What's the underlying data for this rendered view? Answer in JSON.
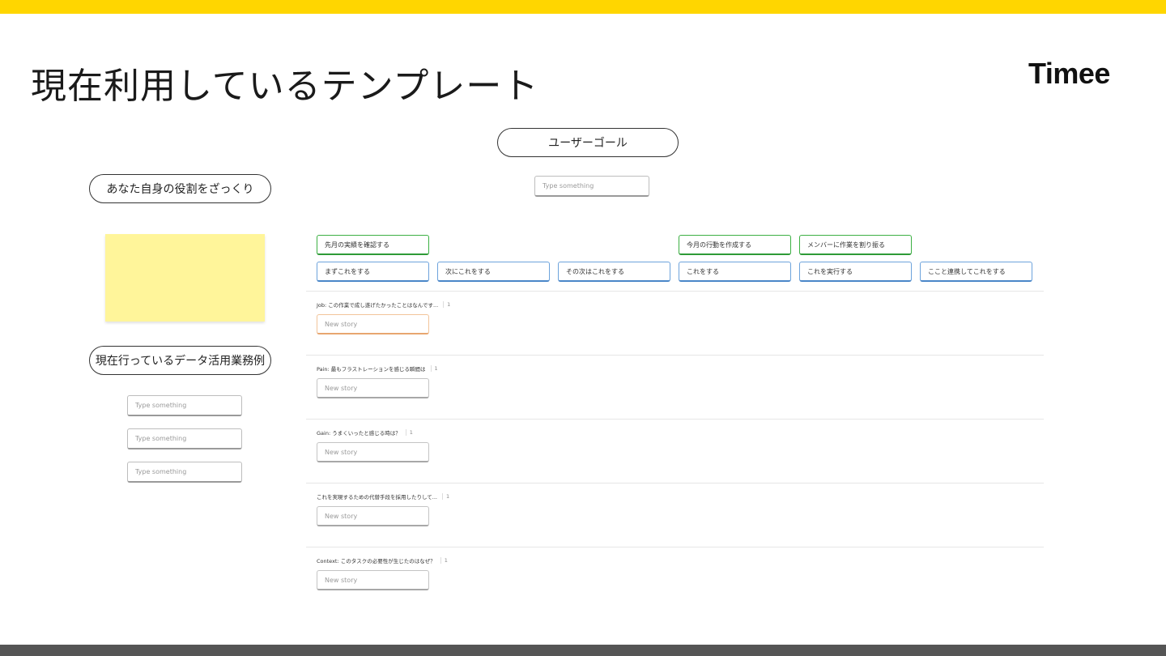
{
  "title": "現在利用しているテンプレート",
  "logo": "Timee",
  "user_goal": {
    "label": "ユーザーゴール",
    "placeholder": "Type something"
  },
  "role": {
    "label": "あなた自身の役割をざっくり"
  },
  "data_usage": {
    "label": "現在行っているデータ活用業務例",
    "placeholders": [
      "Type something",
      "Type something",
      "Type something"
    ]
  },
  "activities": [
    "先月の実績を確認する",
    "今月の行動を作成する",
    "メンバーに作業を割り振る"
  ],
  "steps": [
    "まずこれをする",
    "次にこれをする",
    "その次はこれをする",
    "これをする",
    "これを実行する",
    "ここと連携してこれをする"
  ],
  "lanes": [
    {
      "label": "Job: この作業で成し遂げたかったことはなんです...",
      "count": "1",
      "story": "New story"
    },
    {
      "label": "Pain: 最もフラストレーションを感じる瞬間は",
      "count": "1",
      "story": "New story"
    },
    {
      "label": "Gain: うまくいったと感じる時は？",
      "count": "1",
      "story": "New story"
    },
    {
      "label": "これを実現するための代替手段を採用したりして...",
      "count": "1",
      "story": "New story"
    },
    {
      "label": "Context: このタスクの必要性が生じたのはなぜ？",
      "count": "1",
      "story": "New story"
    }
  ],
  "colors": {
    "top_bar": "#ffd600",
    "bottom_bar": "#555555",
    "sticky": "#fff59a",
    "activity_border": "#3cb043",
    "step_border": "#6da3dc",
    "first_story_border": "#f2c49a"
  }
}
